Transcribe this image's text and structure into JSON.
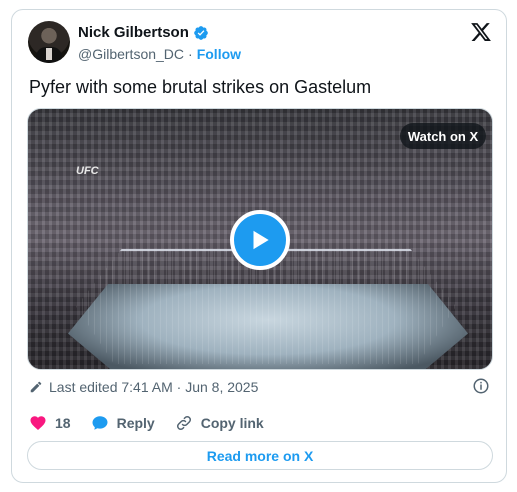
{
  "author": {
    "name": "Nick Gilbertson",
    "handle": "@Gilbertson_DC",
    "separator": "·",
    "follow_label": "Follow"
  },
  "tweet": {
    "text": "Pyfer with some brutal strikes on Gastelum"
  },
  "media": {
    "watch_label": "Watch on X",
    "arena_logo": "UFC"
  },
  "meta": {
    "edited_text": "Last edited 7:41 AM · Jun 8, 2025"
  },
  "actions": {
    "like_count": "18",
    "reply_label": "Reply",
    "copy_label": "Copy link"
  },
  "footer": {
    "read_more_label": "Read more on X"
  },
  "colors": {
    "accent": "#1d9bf0",
    "like": "#f91880",
    "muted": "#536471"
  },
  "icons": {
    "verified": "verified-badge-icon",
    "x_logo": "x-logo-icon",
    "play": "play-icon",
    "pencil": "pencil-icon",
    "info": "info-icon",
    "heart": "heart-icon",
    "reply": "reply-bubble-icon",
    "link": "link-icon"
  }
}
